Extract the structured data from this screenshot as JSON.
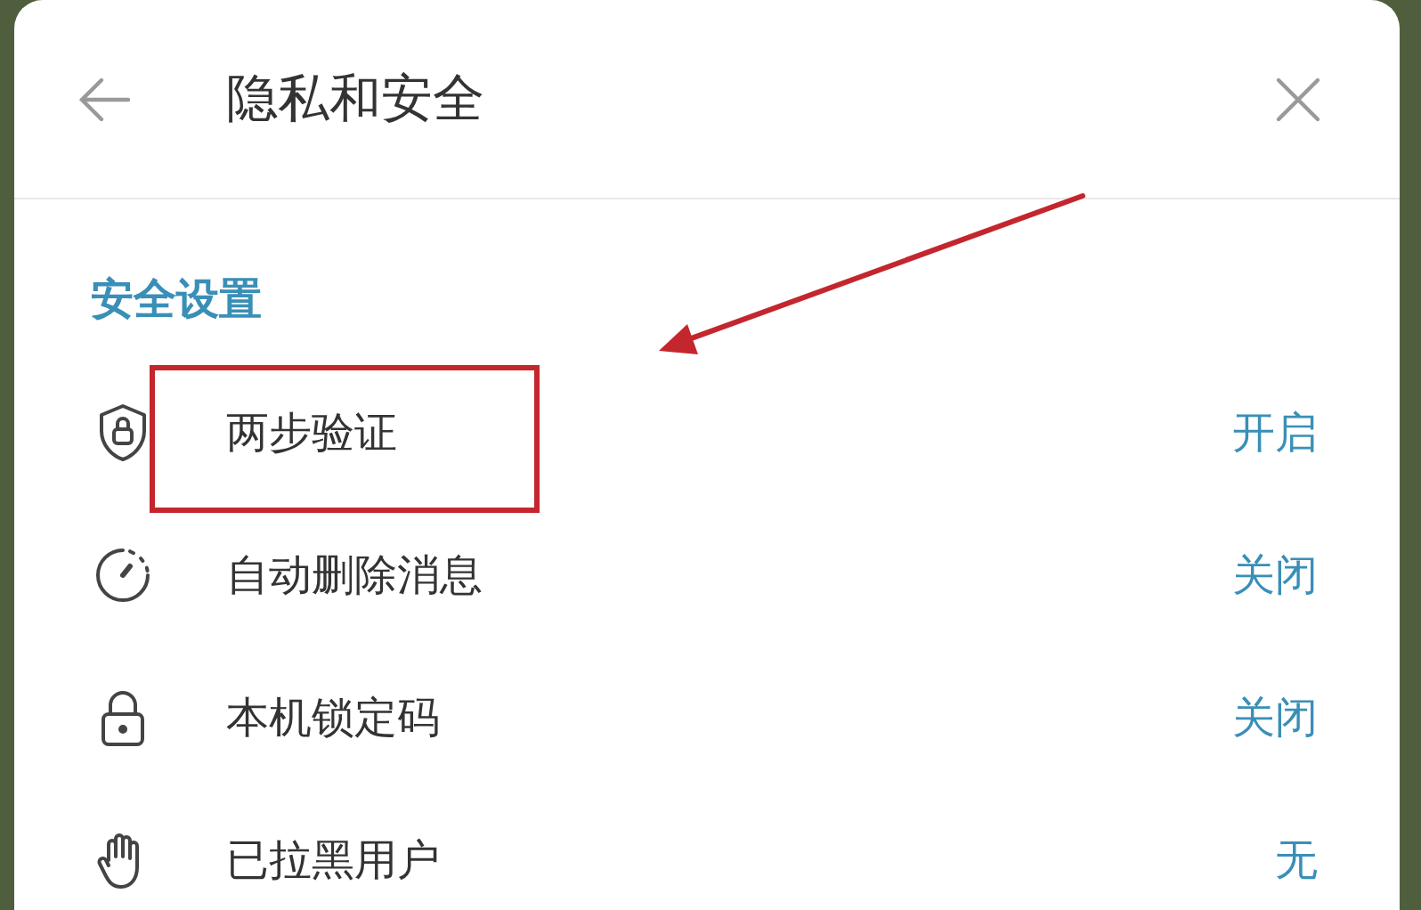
{
  "header": {
    "title": "隐私和安全"
  },
  "section": {
    "title": "安全设置"
  },
  "items": [
    {
      "label": "两步验证",
      "value": "开启",
      "highlighted": true
    },
    {
      "label": "自动删除消息",
      "value": "关闭",
      "highlighted": false
    },
    {
      "label": "本机锁定码",
      "value": "关闭",
      "highlighted": false
    },
    {
      "label": "已拉黑用户",
      "value": "无",
      "highlighted": false
    }
  ]
}
